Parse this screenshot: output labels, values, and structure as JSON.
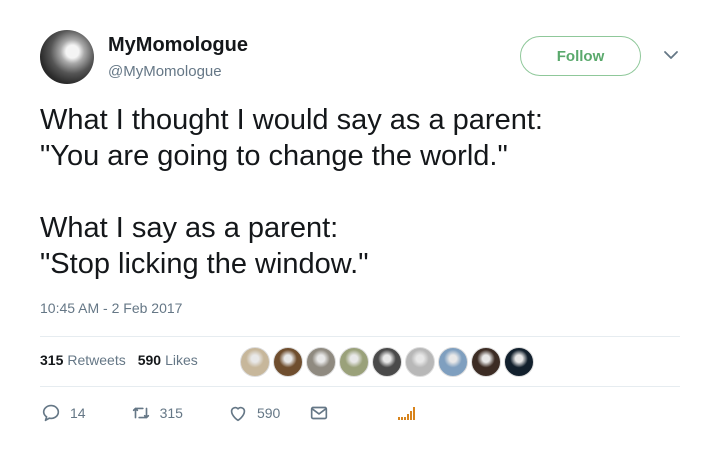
{
  "author": {
    "name": "MyMomologue",
    "handle": "@MyMomologue"
  },
  "follow_label": "Follow",
  "tweet": {
    "line1": "What I thought I would say as a parent:",
    "line2": "\"You are going to change the world.\"",
    "line3": "What I say as a parent:",
    "line4": "\"Stop licking the window.\""
  },
  "timestamp": "10:45 AM - 2 Feb 2017",
  "stats": {
    "retweets_count": "315",
    "retweets_label": "Retweets",
    "likes_count": "590",
    "likes_label": "Likes"
  },
  "liked_by_avatars": [
    {
      "name": "avatar-1",
      "color": "#c7b79b"
    },
    {
      "name": "avatar-2",
      "color": "#6f4e2e"
    },
    {
      "name": "avatar-3",
      "color": "#8f8a80"
    },
    {
      "name": "avatar-4",
      "color": "#9aa17a"
    },
    {
      "name": "avatar-5",
      "color": "#4a4a4a"
    },
    {
      "name": "avatar-6",
      "color": "#b8b8b8"
    },
    {
      "name": "avatar-7",
      "color": "#7f9fbf"
    },
    {
      "name": "avatar-8",
      "color": "#3c2c24"
    },
    {
      "name": "avatar-9",
      "color": "#12202d"
    }
  ],
  "actions": {
    "reply_count": "14",
    "retweet_count": "315",
    "like_count": "590"
  },
  "colors": {
    "follow_green": "#5aa96c",
    "follow_border": "#8fc89a",
    "muted": "#657786",
    "analytics": "#d8841c"
  }
}
